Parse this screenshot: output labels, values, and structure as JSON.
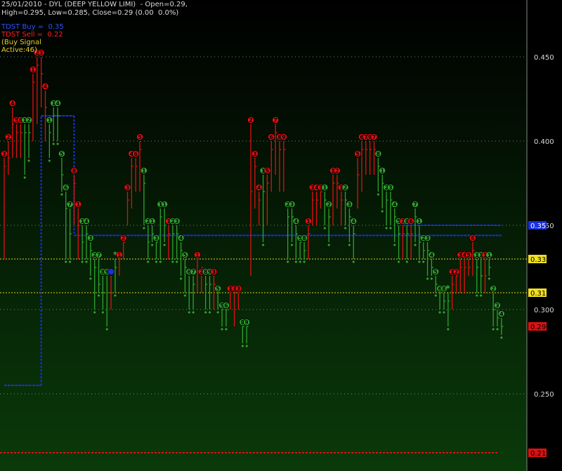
{
  "header": {
    "line1": "25/01/2010 - DYL (DEEP YELLOW LIMI)  - Open=0.29,",
    "line2": "High=0.295, Low=0.285, Close=0.29 (0.00  0.0%)"
  },
  "legend": {
    "buy_label": "TDST Buy =  0.35",
    "sell_label": "TDST Sell =  0.22",
    "signal_label": "(Buy Signal",
    "active_label": "Active:46)"
  },
  "colors": {
    "background_top": "#000000",
    "background_bottom": "#0a3a0a",
    "up_bar": "#2ea32e",
    "down_bar": "#e01010",
    "tdst_buy_line": "#1a2fe0",
    "tdst_sell_line": "#e01010",
    "level_line": "#e8d020",
    "grid": "#d8d8d8",
    "header_text": "#d9d9d9",
    "buy_text": "#3050ff",
    "sell_text": "#ff2020",
    "signal_text": "#e8d020"
  },
  "chart_data": {
    "type": "line",
    "ylim": [
      0.215,
      0.48
    ],
    "yticks": [
      "0.450",
      "0.400",
      "0.350",
      "0.300",
      "0.250"
    ],
    "ytick_values": [
      0.45,
      0.4,
      0.35,
      0.3,
      0.25
    ],
    "price_labels": [
      {
        "text": "0.35",
        "value": 0.35,
        "bg": "#1a2fe0",
        "fg": "#ffffff"
      },
      {
        "text": "0.33",
        "value": 0.33,
        "bg": "#f0e020",
        "fg": "#000000"
      },
      {
        "text": "0.31",
        "value": 0.31,
        "bg": "#f0e020",
        "fg": "#000000"
      },
      {
        "text": "0.29",
        "value": 0.29,
        "bg": "#e01010",
        "fg": "#000000"
      },
      {
        "text": "0.215",
        "value": 0.215,
        "bg": "#e01010",
        "fg": "#000000"
      }
    ],
    "level_lines": [
      0.33,
      0.31
    ],
    "tdst_buy": [
      {
        "from": 0,
        "to": 9,
        "value": 0.255
      },
      {
        "from": 9,
        "to": 17,
        "value": 0.415
      },
      {
        "from": 17,
        "to": 121,
        "value": 0.344
      },
      {
        "from": 97,
        "to": 121,
        "value": 0.35
      }
    ],
    "tdst_sell_value": 0.215,
    "bars": [
      {
        "h": 0.39,
        "l": 0.33,
        "c": 0.385,
        "u": 0,
        "n": "3"
      },
      {
        "h": 0.4,
        "l": 0.38,
        "c": 0.39,
        "u": 0,
        "n": "2"
      },
      {
        "h": 0.42,
        "l": 0.39,
        "c": 0.41,
        "u": 0,
        "n": "4"
      },
      {
        "h": 0.41,
        "l": 0.39,
        "c": 0.405,
        "u": 0,
        "n": "5"
      },
      {
        "h": 0.41,
        "l": 0.39,
        "c": 0.405,
        "u": 0,
        "n": "6"
      },
      {
        "h": 0.41,
        "l": 0.38,
        "c": 0.405,
        "u": 1,
        "n": "1"
      },
      {
        "h": 0.41,
        "l": 0.39,
        "c": 0.405,
        "u": 1,
        "n": "2"
      },
      {
        "h": 0.44,
        "l": 0.4,
        "c": 0.435,
        "u": 0,
        "n": "1"
      },
      {
        "h": 0.45,
        "l": 0.41,
        "c": 0.445,
        "u": 0,
        "n": "2"
      },
      {
        "h": 0.45,
        "l": 0.42,
        "c": 0.44,
        "u": 0,
        "n": "3"
      },
      {
        "h": 0.43,
        "l": 0.4,
        "c": 0.42,
        "u": 0,
        "n": "4"
      },
      {
        "h": 0.41,
        "l": 0.39,
        "c": 0.405,
        "u": 1,
        "n": "1"
      },
      {
        "h": 0.42,
        "l": 0.4,
        "c": 0.415,
        "u": 1,
        "n": "1"
      },
      {
        "h": 0.42,
        "l": 0.4,
        "c": 0.415,
        "u": 1,
        "n": "4"
      },
      {
        "h": 0.39,
        "l": 0.37,
        "c": 0.38,
        "u": 1,
        "n": "5"
      },
      {
        "h": 0.37,
        "l": 0.33,
        "c": 0.36,
        "u": 1,
        "n": "6"
      },
      {
        "h": 0.36,
        "l": 0.33,
        "c": 0.345,
        "u": 1,
        "n": "7"
      },
      {
        "h": 0.38,
        "l": 0.35,
        "c": 0.375,
        "u": 0,
        "n": "8"
      },
      {
        "h": 0.36,
        "l": 0.33,
        "c": 0.35,
        "u": 0,
        "n": "1"
      },
      {
        "h": 0.35,
        "l": 0.33,
        "c": 0.34,
        "u": 1,
        "n": "1"
      },
      {
        "h": 0.35,
        "l": 0.33,
        "c": 0.345,
        "u": 1,
        "n": "4"
      },
      {
        "h": 0.34,
        "l": 0.32,
        "c": 0.335,
        "u": 1,
        "n": "3"
      },
      {
        "h": 0.33,
        "l": 0.3,
        "c": 0.325,
        "u": 1,
        "n": "2"
      },
      {
        "h": 0.33,
        "l": 0.31,
        "c": 0.315,
        "u": 1,
        "n": "7"
      },
      {
        "h": 0.32,
        "l": 0.3,
        "c": 0.31,
        "u": 1,
        "n": "8"
      },
      {
        "h": 0.32,
        "l": 0.29,
        "c": 0.31,
        "u": 1,
        "n": "9"
      },
      {
        "h": 0.32,
        "l": 0.3,
        "c": 0.31,
        "u": 0,
        "n": "B"
      },
      {
        "h": 0.33,
        "l": 0.31,
        "c": 0.325,
        "u": 1,
        "n": "*"
      },
      {
        "h": 0.33,
        "l": 0.32,
        "c": 0.33,
        "u": 0,
        "n": "1"
      },
      {
        "h": 0.34,
        "l": 0.33,
        "c": 0.34,
        "u": 0,
        "n": "2"
      },
      {
        "h": 0.37,
        "l": 0.35,
        "c": 0.365,
        "u": 0,
        "n": "3"
      },
      {
        "h": 0.39,
        "l": 0.36,
        "c": 0.385,
        "u": 0,
        "n": "4"
      },
      {
        "h": 0.39,
        "l": 0.37,
        "c": 0.385,
        "u": 0,
        "n": "6"
      },
      {
        "h": 0.4,
        "l": 0.37,
        "c": 0.395,
        "u": 0,
        "n": "5"
      },
      {
        "h": 0.38,
        "l": 0.35,
        "c": 0.375,
        "u": 1,
        "n": "1"
      },
      {
        "h": 0.35,
        "l": 0.33,
        "c": 0.34,
        "u": 1,
        "n": "2"
      },
      {
        "h": 0.35,
        "l": 0.34,
        "c": 0.345,
        "u": 1,
        "n": "1"
      },
      {
        "h": 0.34,
        "l": 0.33,
        "c": 0.34,
        "u": 1,
        "n": "3"
      },
      {
        "h": 0.36,
        "l": 0.33,
        "c": 0.355,
        "u": 1,
        "n": "1"
      },
      {
        "h": 0.36,
        "l": 0.34,
        "c": 0.35,
        "u": 1,
        "n": "1"
      },
      {
        "h": 0.35,
        "l": 0.33,
        "c": 0.345,
        "u": 0,
        "n": "1"
      },
      {
        "h": 0.35,
        "l": 0.33,
        "c": 0.345,
        "u": 1,
        "n": "2"
      },
      {
        "h": 0.35,
        "l": 0.33,
        "c": 0.345,
        "u": 1,
        "n": "3"
      },
      {
        "h": 0.34,
        "l": 0.32,
        "c": 0.335,
        "u": 1,
        "n": "4"
      },
      {
        "h": 0.33,
        "l": 0.31,
        "c": 0.325,
        "u": 1,
        "n": "5"
      },
      {
        "h": 0.32,
        "l": 0.3,
        "c": 0.31,
        "u": 1,
        "n": "6"
      },
      {
        "h": 0.32,
        "l": 0.3,
        "c": 0.315,
        "u": 1,
        "n": "7"
      },
      {
        "h": 0.33,
        "l": 0.31,
        "c": 0.33,
        "u": 0,
        "n": "1"
      },
      {
        "h": 0.32,
        "l": 0.31,
        "c": 0.325,
        "u": 0,
        "n": "2"
      },
      {
        "h": 0.32,
        "l": 0.3,
        "c": 0.315,
        "u": 1,
        "n": "8"
      },
      {
        "h": 0.32,
        "l": 0.3,
        "c": 0.315,
        "u": 1,
        "n": "9"
      },
      {
        "h": 0.32,
        "l": 0.3,
        "c": 0.315,
        "u": 0,
        "n": "3"
      },
      {
        "h": 0.31,
        "l": 0.3,
        "c": 0.31,
        "u": 1,
        "n": "5"
      },
      {
        "h": 0.3,
        "l": 0.29,
        "c": 0.3,
        "u": 1,
        "n": "5"
      },
      {
        "h": 0.3,
        "l": 0.29,
        "c": 0.3,
        "u": 1,
        "n": "6"
      },
      {
        "h": 0.31,
        "l": 0.3,
        "c": 0.31,
        "u": 0,
        "n": "1"
      },
      {
        "h": 0.31,
        "l": 0.29,
        "c": 0.31,
        "u": 0,
        "n": "3"
      },
      {
        "h": 0.31,
        "l": 0.3,
        "c": 0.31,
        "u": 0,
        "n": "3"
      },
      {
        "h": 0.29,
        "l": 0.28,
        "c": 0.29,
        "u": 1,
        "n": "8"
      },
      {
        "h": 0.29,
        "l": 0.28,
        "c": 0.29,
        "u": 1,
        "n": "9"
      },
      {
        "h": 0.41,
        "l": 0.32,
        "c": 0.37,
        "u": 0,
        "n": "2"
      },
      {
        "h": 0.39,
        "l": 0.36,
        "c": 0.385,
        "u": 0,
        "n": "3"
      },
      {
        "h": 0.37,
        "l": 0.35,
        "c": 0.365,
        "u": 0,
        "n": "4"
      },
      {
        "h": 0.38,
        "l": 0.34,
        "c": 0.37,
        "u": 1,
        "n": "1"
      },
      {
        "h": 0.38,
        "l": 0.35,
        "c": 0.375,
        "u": 0,
        "n": "5"
      },
      {
        "h": 0.4,
        "l": 0.37,
        "c": 0.395,
        "u": 0,
        "n": "6"
      },
      {
        "h": 0.41,
        "l": 0.38,
        "c": 0.405,
        "u": 0,
        "n": "7"
      },
      {
        "h": 0.4,
        "l": 0.37,
        "c": 0.395,
        "u": 0,
        "n": "8"
      },
      {
        "h": 0.4,
        "l": 0.37,
        "c": 0.395,
        "u": 0,
        "n": "9"
      },
      {
        "h": 0.36,
        "l": 0.33,
        "c": 0.355,
        "u": 1,
        "n": "2"
      },
      {
        "h": 0.36,
        "l": 0.34,
        "c": 0.355,
        "u": 1,
        "n": "3"
      },
      {
        "h": 0.35,
        "l": 0.33,
        "c": 0.345,
        "u": 1,
        "n": "4"
      },
      {
        "h": 0.34,
        "l": 0.33,
        "c": 0.34,
        "u": 1,
        "n": "5"
      },
      {
        "h": 0.34,
        "l": 0.33,
        "c": 0.335,
        "u": 1,
        "n": "8"
      },
      {
        "h": 0.35,
        "l": 0.33,
        "c": 0.345,
        "u": 0,
        "n": "1"
      },
      {
        "h": 0.37,
        "l": 0.35,
        "c": 0.365,
        "u": 0,
        "n": "3"
      },
      {
        "h": 0.37,
        "l": 0.35,
        "c": 0.365,
        "u": 0,
        "n": "4"
      },
      {
        "h": 0.37,
        "l": 0.36,
        "c": 0.37,
        "u": 0,
        "n": "3"
      },
      {
        "h": 0.37,
        "l": 0.35,
        "c": 0.365,
        "u": 1,
        "n": "1"
      },
      {
        "h": 0.36,
        "l": 0.34,
        "c": 0.355,
        "u": 1,
        "n": "2"
      },
      {
        "h": 0.38,
        "l": 0.35,
        "c": 0.375,
        "u": 0,
        "n": "1"
      },
      {
        "h": 0.38,
        "l": 0.36,
        "c": 0.375,
        "u": 0,
        "n": "2"
      },
      {
        "h": 0.37,
        "l": 0.35,
        "c": 0.365,
        "u": 0,
        "n": "1"
      },
      {
        "h": 0.37,
        "l": 0.35,
        "c": 0.365,
        "u": 1,
        "n": "2"
      },
      {
        "h": 0.36,
        "l": 0.34,
        "c": 0.355,
        "u": 1,
        "n": "3"
      },
      {
        "h": 0.35,
        "l": 0.33,
        "c": 0.345,
        "u": 1,
        "n": "4"
      },
      {
        "h": 0.39,
        "l": 0.36,
        "c": 0.38,
        "u": 0,
        "n": "5"
      },
      {
        "h": 0.4,
        "l": 0.37,
        "c": 0.395,
        "u": 0,
        "n": "6"
      },
      {
        "h": 0.4,
        "l": 0.38,
        "c": 0.395,
        "u": 0,
        "n": "7"
      },
      {
        "h": 0.4,
        "l": 0.38,
        "c": 0.395,
        "u": 0,
        "n": "9"
      },
      {
        "h": 0.4,
        "l": 0.38,
        "c": 0.395,
        "u": 0,
        "n": "7"
      },
      {
        "h": 0.39,
        "l": 0.37,
        "c": 0.385,
        "u": 1,
        "n": "8"
      },
      {
        "h": 0.38,
        "l": 0.36,
        "c": 0.375,
        "u": 1,
        "n": "1"
      },
      {
        "h": 0.37,
        "l": 0.35,
        "c": 0.365,
        "u": 1,
        "n": "2"
      },
      {
        "h": 0.37,
        "l": 0.35,
        "c": 0.365,
        "u": 1,
        "n": "3"
      },
      {
        "h": 0.36,
        "l": 0.34,
        "c": 0.355,
        "u": 1,
        "n": "4"
      },
      {
        "h": 0.35,
        "l": 0.33,
        "c": 0.345,
        "u": 1,
        "n": "5"
      },
      {
        "h": 0.35,
        "l": 0.33,
        "c": 0.345,
        "u": 0,
        "n": "7"
      },
      {
        "h": 0.35,
        "l": 0.33,
        "c": 0.345,
        "u": 1,
        "n": "8"
      },
      {
        "h": 0.35,
        "l": 0.33,
        "c": 0.345,
        "u": 0,
        "n": "6"
      },
      {
        "h": 0.36,
        "l": 0.34,
        "c": 0.355,
        "u": 1,
        "n": "7"
      },
      {
        "h": 0.35,
        "l": 0.33,
        "c": 0.34,
        "u": 1,
        "n": "1"
      },
      {
        "h": 0.34,
        "l": 0.33,
        "c": 0.335,
        "u": 1,
        "n": "2"
      },
      {
        "h": 0.34,
        "l": 0.32,
        "c": 0.335,
        "u": 1,
        "n": "3"
      },
      {
        "h": 0.33,
        "l": 0.32,
        "c": 0.325,
        "u": 1,
        "n": "4"
      },
      {
        "h": 0.32,
        "l": 0.31,
        "c": 0.315,
        "u": 1,
        "n": "5"
      },
      {
        "h": 0.31,
        "l": 0.3,
        "c": 0.31,
        "u": 1,
        "n": "6"
      },
      {
        "h": 0.31,
        "l": 0.3,
        "c": 0.305,
        "u": 1,
        "n": "8"
      },
      {
        "h": 0.31,
        "l": 0.29,
        "c": 0.305,
        "u": 1,
        "n": "*"
      },
      {
        "h": 0.32,
        "l": 0.3,
        "c": 0.315,
        "u": 0,
        "n": "1"
      },
      {
        "h": 0.32,
        "l": 0.31,
        "c": 0.32,
        "u": 0,
        "n": "2"
      },
      {
        "h": 0.33,
        "l": 0.31,
        "c": 0.325,
        "u": 0,
        "n": "3"
      },
      {
        "h": 0.33,
        "l": 0.31,
        "c": 0.325,
        "u": 0,
        "n": "4"
      },
      {
        "h": 0.33,
        "l": 0.32,
        "c": 0.325,
        "u": 0,
        "n": "5"
      },
      {
        "h": 0.34,
        "l": 0.32,
        "c": 0.335,
        "u": 0,
        "n": "6"
      },
      {
        "h": 0.33,
        "l": 0.31,
        "c": 0.325,
        "u": 1,
        "n": "1"
      },
      {
        "h": 0.33,
        "l": 0.31,
        "c": 0.32,
        "u": 1,
        "n": "1"
      },
      {
        "h": 0.33,
        "l": 0.31,
        "c": 0.32,
        "u": 0,
        "n": "1"
      },
      {
        "h": 0.33,
        "l": 0.32,
        "c": 0.325,
        "u": 1,
        "n": "1"
      },
      {
        "h": 0.31,
        "l": 0.29,
        "c": 0.3,
        "u": 1,
        "n": "2"
      },
      {
        "h": 0.3,
        "l": 0.29,
        "c": 0.295,
        "u": 1,
        "n": "3"
      },
      {
        "h": 0.295,
        "l": 0.285,
        "c": 0.29,
        "u": 1,
        "n": "4"
      }
    ]
  }
}
